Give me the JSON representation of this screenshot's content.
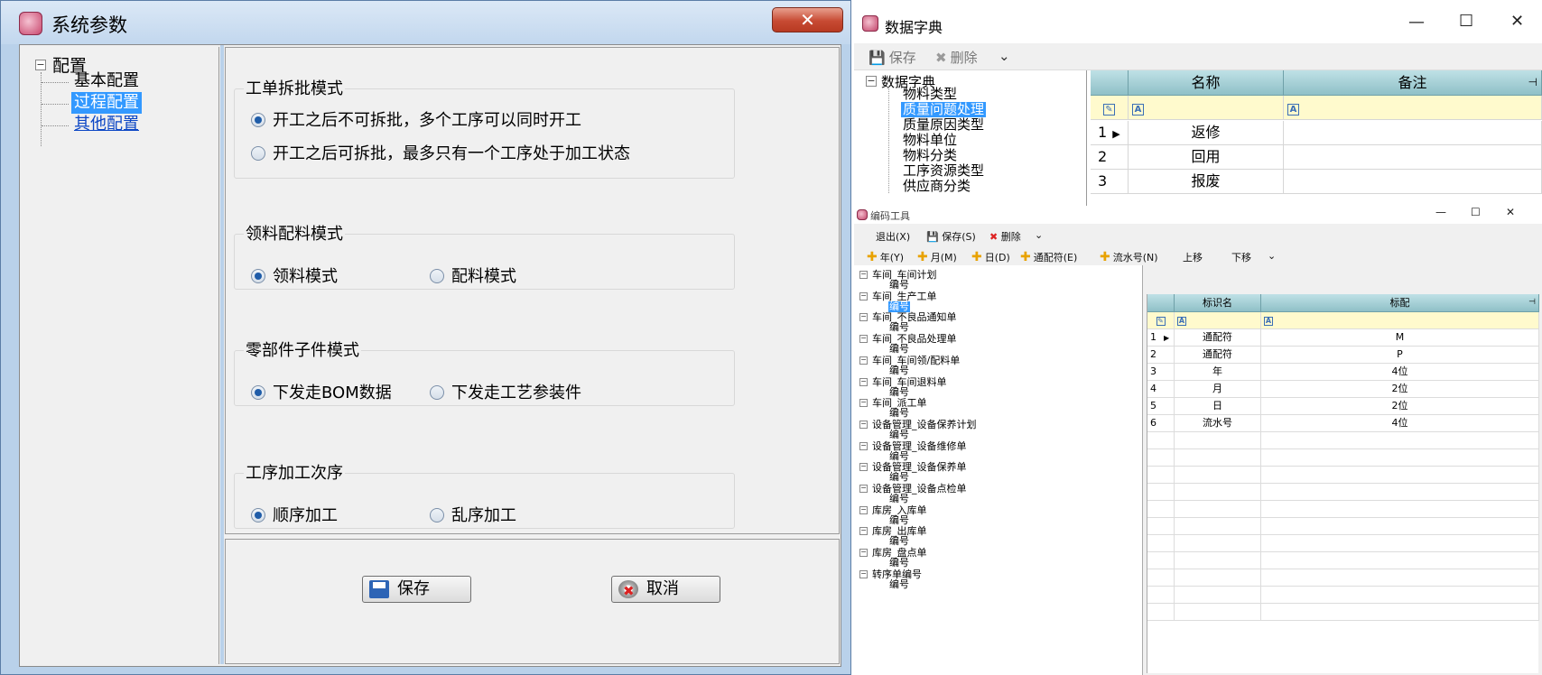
{
  "sys_window": {
    "title": "系统参数",
    "close": "✕",
    "tree": {
      "root": "配置",
      "items": [
        "基本配置",
        "过程配置",
        "其他配置"
      ]
    },
    "groups": [
      {
        "title": "工单拆批模式",
        "options": [
          {
            "label": "开工之后不可拆批，多个工序可以同时开工",
            "checked": true
          },
          {
            "label": "开工之后可拆批，最多只有一个工序处于加工状态",
            "checked": false
          }
        ]
      },
      {
        "title": "领料配料模式",
        "options": [
          {
            "label": "领料模式",
            "checked": true
          },
          {
            "label": "配料模式",
            "checked": false
          }
        ]
      },
      {
        "title": "零部件子件模式",
        "options": [
          {
            "label": "下发走BOM数据",
            "checked": true
          },
          {
            "label": "下发走工艺参装件",
            "checked": false
          }
        ]
      },
      {
        "title": "工序加工次序",
        "options": [
          {
            "label": "顺序加工",
            "checked": true
          },
          {
            "label": "乱序加工",
            "checked": false
          }
        ]
      }
    ],
    "save_label": "保存",
    "cancel_label": "取消"
  },
  "dict_window": {
    "title": "数据字典",
    "min": "—",
    "max": "☐",
    "close": "✕",
    "toolbar": {
      "save": "保存",
      "delete": "删除",
      "more": "⌄"
    },
    "tree": {
      "root": "数据字典",
      "items": [
        "物料类型",
        "质量问题处理",
        "质量原因类型",
        "物料单位",
        "物料分类",
        "工序资源类型",
        "供应商分类"
      ]
    },
    "grid": {
      "columns": [
        "名称",
        "备注"
      ],
      "pin": "⊣",
      "rows": [
        {
          "num": "1",
          "name": "返修",
          "note": ""
        },
        {
          "num": "2",
          "name": "回用",
          "note": ""
        },
        {
          "num": "3",
          "name": "报废",
          "note": ""
        }
      ]
    }
  },
  "enc_window": {
    "title": "编码工具",
    "min": "—",
    "max": "☐",
    "close": "✕",
    "toolbar1": {
      "exit": "退出(X)",
      "save": "保存(S)",
      "delete": "删除",
      "more": "⌄"
    },
    "toolbar2": [
      "年(Y)",
      "月(M)",
      "日(D)",
      "通配符(E)",
      "流水号(N)"
    ],
    "toolbar2_plain": [
      "上移",
      "下移",
      "⌄"
    ],
    "tree": [
      {
        "parent": "车间_车间计划",
        "child": "编号"
      },
      {
        "parent": "车间_生产工单",
        "child": "编号"
      },
      {
        "parent": "车间_不良品通知单",
        "child": "编号"
      },
      {
        "parent": "车间_不良品处理单",
        "child": "编号"
      },
      {
        "parent": "车间_车间领/配料单",
        "child": "编号"
      },
      {
        "parent": "车间_车间退料单",
        "child": "编号"
      },
      {
        "parent": "车间_派工单",
        "child": "编号"
      },
      {
        "parent": "设备管理_设备保养计划",
        "child": "编号"
      },
      {
        "parent": "设备管理_设备维修单",
        "child": "编号"
      },
      {
        "parent": "设备管理_设备保养单",
        "child": "编号"
      },
      {
        "parent": "设备管理_设备点检单",
        "child": "编号"
      },
      {
        "parent": "库房_入库单",
        "child": "编号"
      },
      {
        "parent": "库房_出库单",
        "child": "编号"
      },
      {
        "parent": "库房_盘点单",
        "child": "编号"
      },
      {
        "parent": "转序单编号",
        "child": "编号"
      }
    ],
    "grid": {
      "columns": [
        "标识名",
        "标配"
      ],
      "pin": "⊣",
      "rows": [
        {
          "num": "1",
          "name": "通配符",
          "value": "M"
        },
        {
          "num": "2",
          "name": "通配符",
          "value": "P"
        },
        {
          "num": "3",
          "name": "年",
          "value": "4位"
        },
        {
          "num": "4",
          "name": "月",
          "value": "2位"
        },
        {
          "num": "5",
          "name": "日",
          "value": "2位"
        },
        {
          "num": "6",
          "name": "流水号",
          "value": "4位"
        }
      ]
    }
  }
}
